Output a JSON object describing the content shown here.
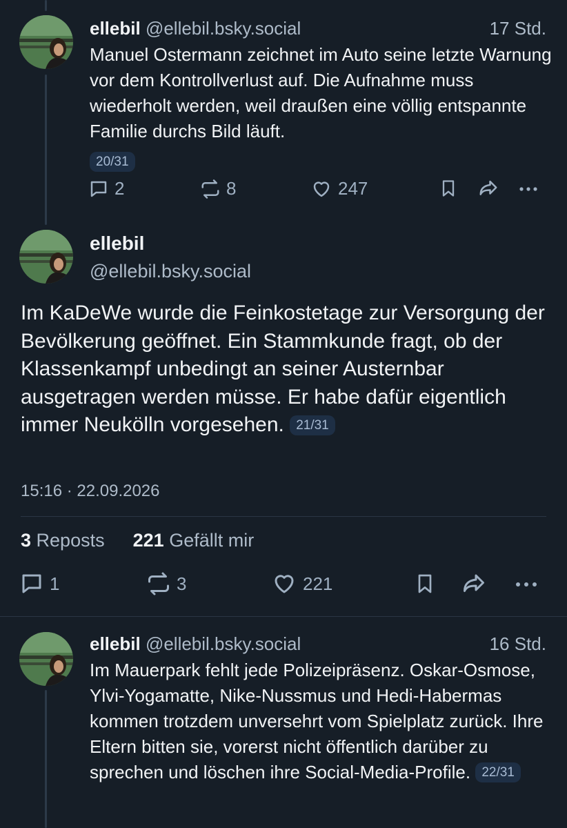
{
  "colors": {
    "background": "#161e27",
    "text": "#f1f3f5",
    "muted": "#aebbc9",
    "badge_bg": "#1e2f45"
  },
  "posts": [
    {
      "author_name": "ellebil",
      "author_handle": "@ellebil.bsky.social",
      "time_ago": "17 Std.",
      "text": "Manuel Ostermann zeichnet im Auto seine letzte Warnung vor dem Kontrollverlust auf. Die Aufnahme muss wiederholt werden, weil draußen eine völlig entspannte Familie durchs Bild läuft.",
      "thread_counter": "20/31",
      "replies": "2",
      "reposts": "8",
      "likes": "247"
    },
    {
      "author_name": "ellebil",
      "author_handle": "@ellebil.bsky.social",
      "text": "Im KaDeWe wurde die Feinkostetage zur Versorgung der Bevölkerung geöffnet. Ein Stammkunde fragt, ob der Klassenkampf unbedingt an seiner Austernbar ausgetragen werden müsse. Er habe dafür eigentlich immer Neukölln vorgesehen.",
      "thread_counter": "21/31",
      "timestamp": "15:16 · 22.09.2026",
      "reposts_count": "3",
      "reposts_label": "Reposts",
      "likes_count": "221",
      "likes_label": "Gefällt mir",
      "replies": "1",
      "reposts": "3",
      "likes": "221"
    },
    {
      "author_name": "ellebil",
      "author_handle": "@ellebil.bsky.social",
      "time_ago": "16 Std.",
      "text": "Im Mauerpark fehlt jede Polizeipräsenz. Oskar-Osmose, Ylvi-Yogamatte, Nike-Nussmus und Hedi-Habermas kommen trotzdem unversehrt vom Spielplatz zurück. Ihre Eltern bitten sie, vorerst nicht öffentlich darüber zu sprechen und löschen ihre Social-Media-Profile.",
      "thread_counter": "22/31"
    }
  ]
}
